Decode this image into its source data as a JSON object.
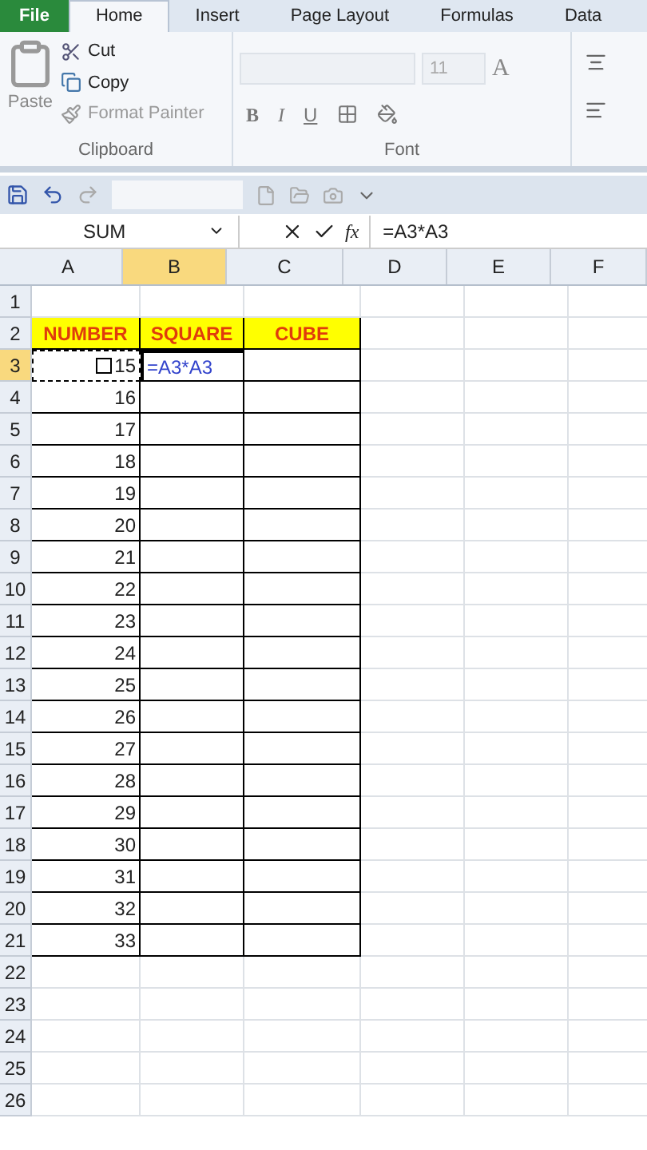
{
  "tabs": [
    {
      "label": "File",
      "kind": "file",
      "selected": false
    },
    {
      "label": "Home",
      "kind": "tab",
      "selected": true
    },
    {
      "label": "Insert",
      "kind": "tab",
      "selected": false
    },
    {
      "label": "Page Layout",
      "kind": "tab",
      "selected": false
    },
    {
      "label": "Formulas",
      "kind": "tab",
      "selected": false
    },
    {
      "label": "Data",
      "kind": "tab",
      "selected": false
    }
  ],
  "clipboard": {
    "paste": "Paste",
    "cut": "Cut",
    "copy": "Copy",
    "format_painter": "Format Painter",
    "label": "Clipboard"
  },
  "font": {
    "size": "11",
    "label": "Font",
    "bold": "B",
    "italic": "I",
    "underline": "U",
    "grow": "A"
  },
  "name_box": "SUM",
  "function": "fx",
  "formula": "=A3*A3",
  "columns": [
    {
      "label": "A",
      "selected": false
    },
    {
      "label": "B",
      "selected": true
    },
    {
      "label": "C",
      "selected": false
    },
    {
      "label": "D",
      "selected": false
    },
    {
      "label": "E",
      "selected": false
    },
    {
      "label": "F",
      "selected": false
    }
  ],
  "rows": [
    {
      "label": "1",
      "selected": false,
      "cells": []
    },
    {
      "label": "2",
      "selected": false,
      "kind": "header",
      "cells": [
        "NUMBER",
        "SQUARE",
        "CUBE"
      ]
    },
    {
      "label": "3",
      "selected": true,
      "cells": [
        "15",
        "=A3*A3",
        ""
      ]
    },
    {
      "label": "4",
      "selected": false,
      "cells": [
        "16",
        "",
        ""
      ]
    },
    {
      "label": "5",
      "selected": false,
      "cells": [
        "17",
        "",
        ""
      ]
    },
    {
      "label": "6",
      "selected": false,
      "cells": [
        "18",
        "",
        ""
      ]
    },
    {
      "label": "7",
      "selected": false,
      "cells": [
        "19",
        "",
        ""
      ]
    },
    {
      "label": "8",
      "selected": false,
      "cells": [
        "20",
        "",
        ""
      ]
    },
    {
      "label": "9",
      "selected": false,
      "cells": [
        "21",
        "",
        ""
      ]
    },
    {
      "label": "10",
      "selected": false,
      "cells": [
        "22",
        "",
        ""
      ]
    },
    {
      "label": "11",
      "selected": false,
      "cells": [
        "23",
        "",
        ""
      ]
    },
    {
      "label": "12",
      "selected": false,
      "cells": [
        "24",
        "",
        ""
      ]
    },
    {
      "label": "13",
      "selected": false,
      "cells": [
        "25",
        "",
        ""
      ]
    },
    {
      "label": "14",
      "selected": false,
      "cells": [
        "26",
        "",
        ""
      ]
    },
    {
      "label": "15",
      "selected": false,
      "cells": [
        "27",
        "",
        ""
      ]
    },
    {
      "label": "16",
      "selected": false,
      "cells": [
        "28",
        "",
        ""
      ]
    },
    {
      "label": "17",
      "selected": false,
      "cells": [
        "29",
        "",
        ""
      ]
    },
    {
      "label": "18",
      "selected": false,
      "cells": [
        "30",
        "",
        ""
      ]
    },
    {
      "label": "19",
      "selected": false,
      "cells": [
        "31",
        "",
        ""
      ]
    },
    {
      "label": "20",
      "selected": false,
      "cells": [
        "32",
        "",
        ""
      ]
    },
    {
      "label": "21",
      "selected": false,
      "cells": [
        "33",
        "",
        ""
      ]
    },
    {
      "label": "22",
      "selected": false,
      "cells": []
    },
    {
      "label": "23",
      "selected": false,
      "cells": []
    },
    {
      "label": "24",
      "selected": false,
      "cells": []
    },
    {
      "label": "25",
      "selected": false,
      "cells": []
    },
    {
      "label": "26",
      "selected": false,
      "cells": []
    }
  ]
}
